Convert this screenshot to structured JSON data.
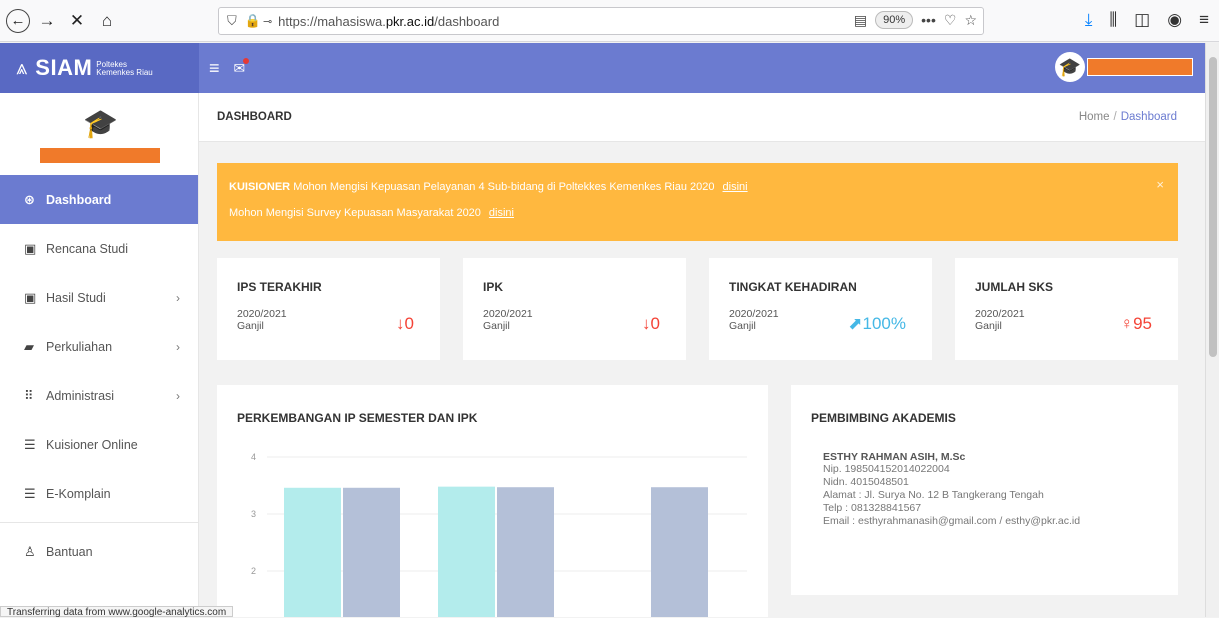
{
  "browser": {
    "url_prefix": "https://mahasiswa.",
    "url_domain": "pkr.ac.id",
    "url_path": "/dashboard",
    "zoom": "90%"
  },
  "app": {
    "brand": "SIAM",
    "brand_sub_1": "Poltekes",
    "brand_sub_2": "Kemenkes Riau"
  },
  "sidebar": {
    "items": [
      {
        "label": "Dashboard",
        "icon": "palette-icon",
        "active": true
      },
      {
        "label": "Rencana Studi",
        "icon": "presentation-icon"
      },
      {
        "label": "Hasil Studi",
        "icon": "presentation-icon",
        "chevron": true
      },
      {
        "label": "Perkuliahan",
        "icon": "book-icon",
        "chevron": true
      },
      {
        "label": "Administrasi",
        "icon": "grid-icon",
        "chevron": true
      },
      {
        "label": "Kuisioner Online",
        "icon": "list-icon"
      },
      {
        "label": "E-Komplain",
        "icon": "list-icon"
      },
      {
        "label": "Bantuan",
        "icon": "linux-icon"
      }
    ]
  },
  "page": {
    "title": "DASHBOARD",
    "breadcrumb_home": "Home",
    "breadcrumb_sep": "/",
    "breadcrumb_current": "Dashboard"
  },
  "alert": {
    "prefix": "KUISIONER",
    "line1": "Mohon Mengisi Kepuasan Pelayanan 4 Sub-bidang di Poltekkes Kemenkes Riau 2020",
    "line2": "Mohon Mengisi Survey Kepuasan Masyarakat 2020",
    "link": "disini",
    "close": "×"
  },
  "stats": [
    {
      "label": "IPS TERAKHIR",
      "year": "2020/2021",
      "term": "Ganjil",
      "icon": "↓",
      "value": "0",
      "color": "#f44336"
    },
    {
      "label": "IPK",
      "year": "2020/2021",
      "term": "Ganjil",
      "icon": "↓",
      "value": "0",
      "color": "#f44336"
    },
    {
      "label": "TINGKAT KEHADIRAN",
      "year": "2020/2021",
      "term": "Ganjil",
      "icon": "⬈",
      "value": "100%",
      "color": "#45b8e6"
    },
    {
      "label": "JUMLAH SKS",
      "year": "2020/2021",
      "term": "Ganjil",
      "icon": "♀",
      "value": "95",
      "color": "#f44336"
    }
  ],
  "chart_card": {
    "title": "PERKEMBANGAN IP SEMESTER DAN IPK"
  },
  "chart_data": {
    "type": "bar",
    "title": "PERKEMBANGAN IP SEMESTER DAN IPK",
    "categories": [
      "",
      "",
      ""
    ],
    "series": [
      {
        "values": [
          3.46,
          3.48,
          null
        ],
        "color": "#b3ecec"
      },
      {
        "values": [
          3.46,
          3.47,
          3.47
        ],
        "color": "#b4c0d8"
      }
    ],
    "yticks": [
      "4",
      "3",
      "2"
    ],
    "ylim": [
      1,
      4
    ]
  },
  "advisor": {
    "title": "PEMBIMBING AKADEMIS",
    "name": "ESTHY RAHMAN ASIH, M.Sc",
    "nip": "Nip. 198504152014022004",
    "nidn": "Nidn. 4015048501",
    "alamat": "Alamat : Jl. Surya No. 12 B Tangkerang Tengah",
    "telp": "Telp : 081328841567",
    "email": "Email : esthyrahmanasih@gmail.com / esthy@pkr.ac.id"
  },
  "status": "Transferring data from www.google-analytics.com"
}
